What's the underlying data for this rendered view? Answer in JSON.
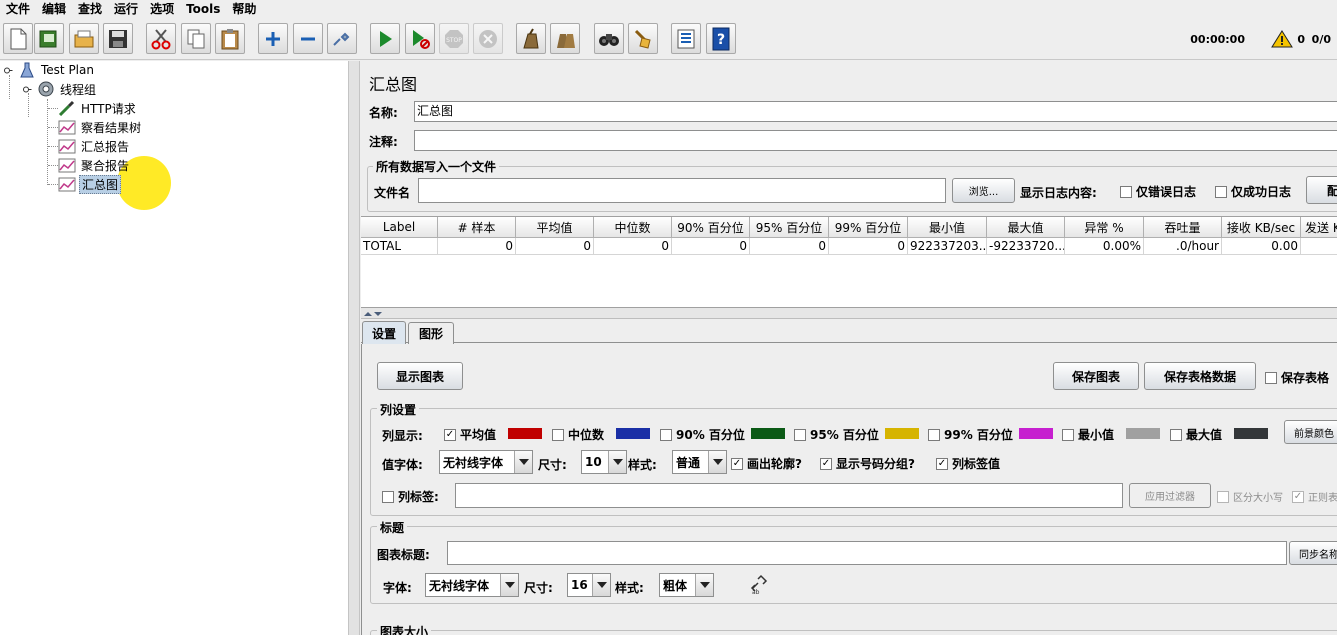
{
  "menu": [
    "文件",
    "编辑",
    "查找",
    "运行",
    "选项",
    "Tools",
    "帮助"
  ],
  "toolbar": {
    "buttons": [
      {
        "name": "new-icon"
      },
      {
        "name": "templates-icon"
      },
      {
        "name": "open-icon"
      },
      {
        "name": "save-icon"
      },
      {
        "name": "cut-icon"
      },
      {
        "name": "copy-icon"
      },
      {
        "name": "paste-icon"
      },
      {
        "name": "expand-icon"
      },
      {
        "name": "collapse-icon"
      },
      {
        "name": "toggle-icon"
      },
      {
        "name": "start-icon"
      },
      {
        "name": "start-no-pauses-icon"
      },
      {
        "name": "stop-icon"
      },
      {
        "name": "shutdown-icon"
      },
      {
        "name": "clear-icon"
      },
      {
        "name": "clear-all-icon"
      },
      {
        "name": "search-icon"
      },
      {
        "name": "reset-search-icon"
      },
      {
        "name": "function-helper-icon"
      },
      {
        "name": "help-icon"
      }
    ],
    "timer": "00:00:00",
    "warning_count": "0",
    "threads": "0/0"
  },
  "tree": {
    "nodes": [
      {
        "label": "Test Plan",
        "icon": "test-plan-icon"
      },
      {
        "label": "线程组",
        "icon": "thread-group-gear-icon"
      },
      {
        "label": "HTTP请求",
        "icon": "sampler-pipette-icon"
      },
      {
        "label": "察看结果树",
        "icon": "listener-graph-icon"
      },
      {
        "label": "汇总报告",
        "icon": "listener-graph-icon"
      },
      {
        "label": "聚合报告",
        "icon": "listener-graph-icon"
      },
      {
        "label": "汇总图",
        "icon": "listener-graph-icon",
        "selected": true
      }
    ]
  },
  "panel": {
    "title": "汇总图",
    "name_label": "名称:",
    "name_value": "汇总图",
    "comment_label": "注释:",
    "comment_value": "",
    "file_group_title": "所有数据写入一个文件",
    "filename_label": "文件名",
    "filename_value": "",
    "browse_button": "浏览...",
    "log_display_label": "显示日志内容:",
    "errors_only": "仅错误日志",
    "success_only": "仅成功日志",
    "configure_button": "配置"
  },
  "table": {
    "columns": [
      "Label",
      "# 样本",
      "平均值",
      "中位数",
      "90% 百分位",
      "95% 百分位",
      "99% 百分位",
      "最小值",
      "最大值",
      "异常 %",
      "吞吐量",
      "接收 KB/sec",
      "发送 KB/sec"
    ],
    "rows": [
      [
        "TOTAL",
        "0",
        "0",
        "0",
        "0",
        "0",
        "0",
        "922337203...",
        "-92233720...",
        "0.00%",
        ".0/hour",
        "0.00",
        ""
      ]
    ]
  },
  "tabs": [
    "设置",
    "图形"
  ],
  "settings": {
    "show_graph_button": "显示图表",
    "save_graph_button": "保存图表",
    "save_table_button": "保存表格数据",
    "save_table_header": "保存表格",
    "columns_group": "列设置",
    "columns_display_label": "列显示:",
    "column_toggles": [
      {
        "label": "平均值",
        "checked": true,
        "color": "#c00000"
      },
      {
        "label": "中位数",
        "checked": false,
        "color": "#1a2fa6"
      },
      {
        "label": "90% 百分位",
        "checked": false,
        "color": "#0b5a16"
      },
      {
        "label": "95% 百分位",
        "checked": false,
        "color": "#d6b400"
      },
      {
        "label": "99% 百分位",
        "checked": false,
        "color": "#c61fcf"
      },
      {
        "label": "最小值",
        "checked": false,
        "color": "#a0a0a0"
      },
      {
        "label": "最大值",
        "checked": false,
        "color": "#333639"
      }
    ],
    "foreground_color_button": "前景颜色",
    "value_font_label": "值字体:",
    "value_font": "无衬线字体",
    "size_label": "尺寸:",
    "value_size": "10",
    "style_label": "样式:",
    "value_style": "普通",
    "draw_outline": "画出轮廓?",
    "show_number_grouping": "显示号码分组?",
    "value_labels": "列标签值",
    "column_label_label": "列标签:",
    "column_label_value": "",
    "apply_filter_button": "应用过滤器",
    "case_sensitive": "区分大小写",
    "regex": "正则表达式",
    "title_group": "标题",
    "graph_title_label": "图表标题:",
    "graph_title_value": "",
    "sync_name_button": "同步名称",
    "title_font_label": "字体:",
    "title_font": "无衬线字体",
    "title_size_label": "尺寸:",
    "title_size": "16",
    "title_style_label": "样式:",
    "title_style": "粗体",
    "size_group": "图表大小"
  }
}
